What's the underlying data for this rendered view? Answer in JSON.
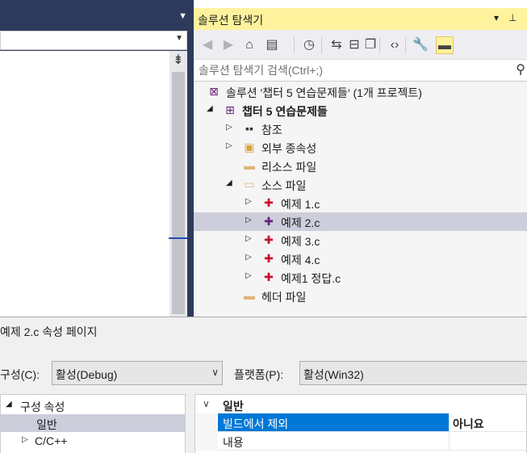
{
  "editor": {
    "title_dropdown_icon": "chevron-down-icon",
    "nav_dropdown_icon": "chevron-down-icon",
    "split_icon": "splitter-icon"
  },
  "solution_explorer": {
    "title": "솔루션 탐색기",
    "title_controls": {
      "dropdown": "▾",
      "pin": "pin-icon"
    },
    "toolbar": [
      {
        "name": "back-icon",
        "glyph": "◀",
        "enabled": false
      },
      {
        "name": "forward-icon",
        "glyph": "▶",
        "enabled": false
      },
      {
        "name": "home-icon",
        "glyph": "⌂",
        "enabled": true
      },
      {
        "name": "switch-views-icon",
        "glyph": "▤",
        "enabled": true
      },
      {
        "name": "history-icon",
        "glyph": "◷",
        "enabled": true
      },
      {
        "name": "sync-icon",
        "glyph": "⇆",
        "enabled": true
      },
      {
        "name": "collapse-all-icon",
        "glyph": "⊟",
        "enabled": true
      },
      {
        "name": "show-all-files-icon",
        "glyph": "❐",
        "enabled": true
      },
      {
        "name": "view-code-icon",
        "glyph": "‹›",
        "enabled": true
      },
      {
        "name": "properties-icon",
        "glyph": "🔧",
        "enabled": true
      },
      {
        "name": "preview-icon",
        "glyph": "▬",
        "enabled": true,
        "active": true
      }
    ],
    "search": {
      "placeholder": "솔루션 탐색기 검색(Ctrl+;)",
      "icon": "search-icon"
    },
    "tree": [
      {
        "label": "솔루션 '챕터 5 연습문제들' (1개 프로젝트)",
        "level": 0,
        "icon": "solution-icon",
        "expander": ""
      },
      {
        "label": "챕터 5 연습문제들",
        "level": 1,
        "icon": "project-icon",
        "expander": "expanded",
        "bold": true
      },
      {
        "label": "참조",
        "level": 2,
        "icon": "references-icon",
        "expander": "collapsed"
      },
      {
        "label": "외부 종속성",
        "level": 2,
        "icon": "external-deps-icon",
        "expander": "collapsed"
      },
      {
        "label": "리소스 파일",
        "level": 2,
        "icon": "folder-icon",
        "expander": ""
      },
      {
        "label": "소스 파일",
        "level": 2,
        "icon": "folder-open-icon",
        "expander": "expanded"
      },
      {
        "label": "예제 1.c",
        "level": 3,
        "icon": "c-file-excluded-icon",
        "expander": "collapsed"
      },
      {
        "label": "예제 2.c",
        "level": 3,
        "icon": "c-file-icon",
        "expander": "collapsed",
        "selected": true
      },
      {
        "label": "예제 3.c",
        "level": 3,
        "icon": "c-file-excluded-icon",
        "expander": "collapsed"
      },
      {
        "label": "예제 4.c",
        "level": 3,
        "icon": "c-file-excluded-icon",
        "expander": "collapsed"
      },
      {
        "label": "예제1 정답.c",
        "level": 3,
        "icon": "c-file-excluded-icon",
        "expander": "collapsed"
      },
      {
        "label": "헤더 파일",
        "level": 2,
        "icon": "folder-icon",
        "expander": ""
      }
    ]
  },
  "property_page": {
    "title": "예제 2.c 속성 페이지",
    "config_label": "구성(C):",
    "config_value": "활성(Debug)",
    "platform_label": "플랫폼(P):",
    "platform_value": "활성(Win32)",
    "tree": [
      {
        "label": "구성 속성",
        "expander": "expanded"
      },
      {
        "label": "일반",
        "selected": true
      },
      {
        "label": "C/C++",
        "expander": "collapsed"
      }
    ],
    "grid": {
      "category": "일반",
      "rows": [
        {
          "name": "빌드에서 제외",
          "value": "아니요",
          "selected": true
        },
        {
          "name": "내용",
          "value": ""
        }
      ]
    }
  }
}
